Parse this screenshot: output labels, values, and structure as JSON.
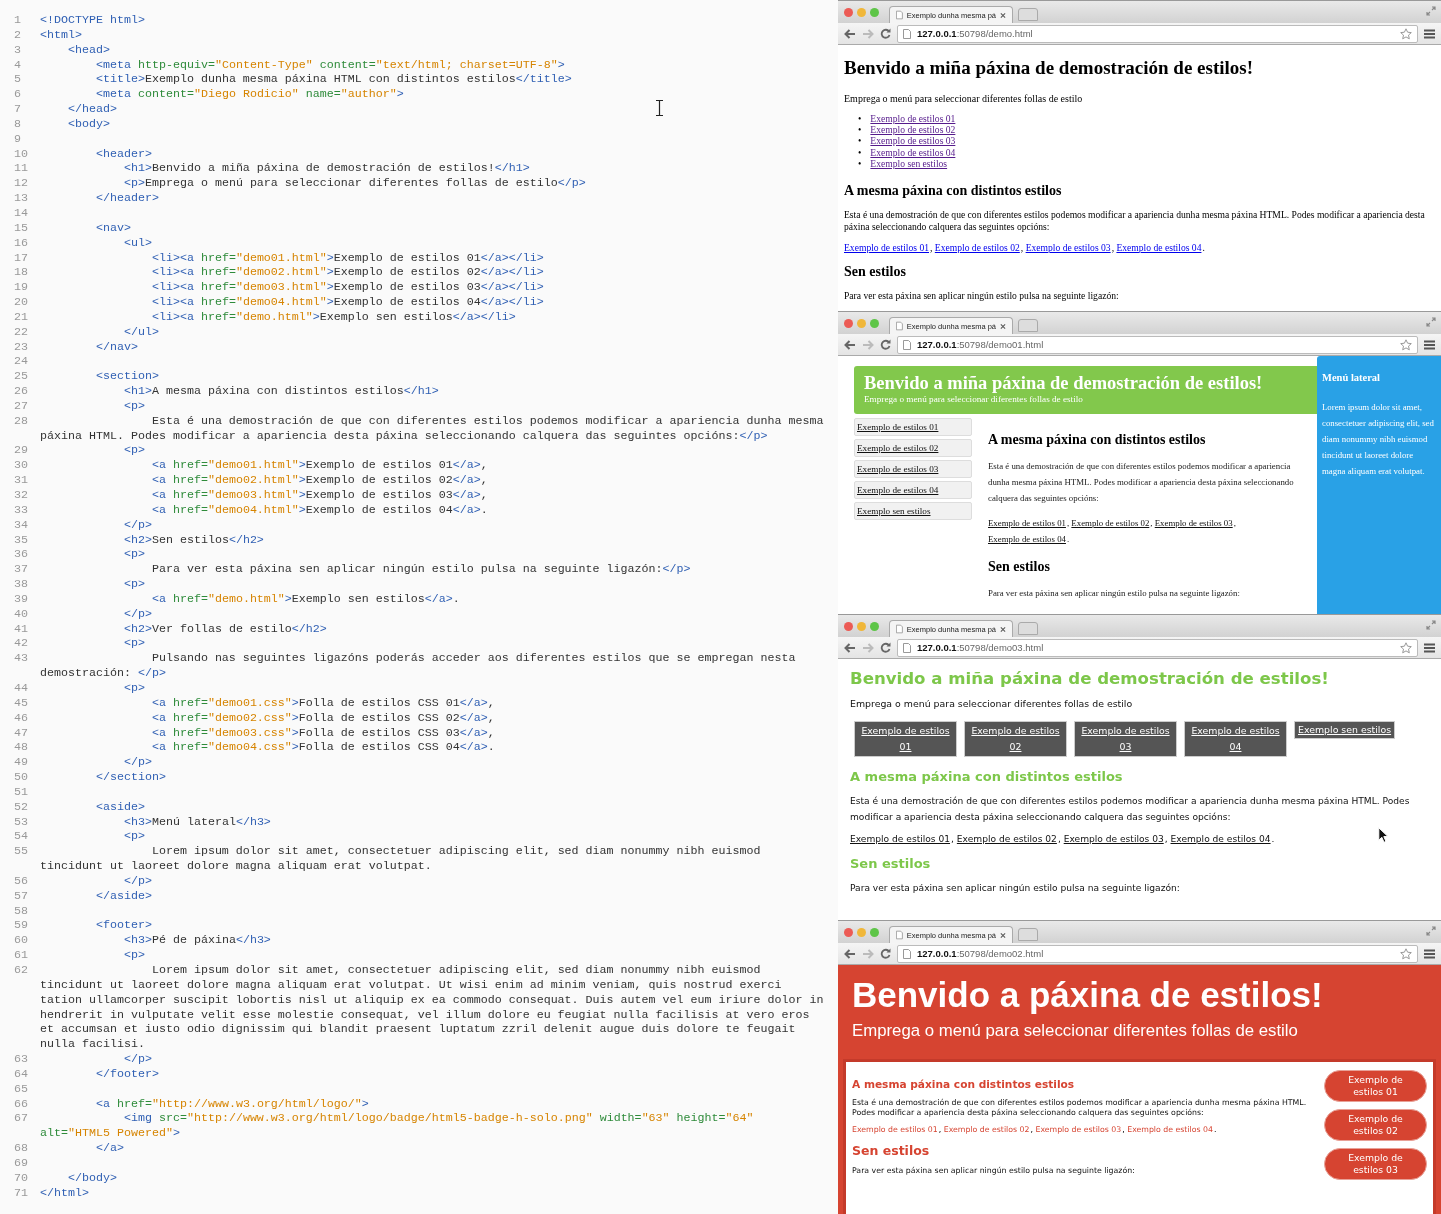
{
  "editor": {
    "lines": [
      {
        "number": "1",
        "text": "<!DOCTYPE html>"
      },
      {
        "number": "2",
        "text": "<html>"
      },
      {
        "number": "3",
        "text": "    <head>"
      },
      {
        "number": "4",
        "text": "        <meta http-equiv=\"Content-Type\" content=\"text/html; charset=UTF-8\">"
      },
      {
        "number": "5",
        "text": "        <title>Exemplo dunha mesma páxina HTML con distintos estilos</title>"
      },
      {
        "number": "6",
        "text": "        <meta content=\"Diego Rodicio\" name=\"author\">"
      },
      {
        "number": "7",
        "text": "    </head>"
      },
      {
        "number": "8",
        "text": "    <body>"
      },
      {
        "number": "9"
      },
      {
        "number": "10",
        "text": "        <header>"
      },
      {
        "number": "11",
        "text": "            <h1>Benvido a miña páxina de demostración de estilos!</h1>"
      },
      {
        "number": "12",
        "text": "            <p>Emprega o menú para seleccionar diferentes follas de estilo</p>"
      },
      {
        "number": "13",
        "text": "        </header>"
      },
      {
        "number": "14"
      },
      {
        "number": "15",
        "text": "        <nav>"
      },
      {
        "number": "16",
        "text": "            <ul>"
      },
      {
        "number": "17",
        "text": "                <li><a href=\"demo01.html\">Exemplo de estilos 01</a></li>"
      },
      {
        "number": "18",
        "text": "                <li><a href=\"demo02.html\">Exemplo de estilos 02</a></li>"
      },
      {
        "number": "19",
        "text": "                <li><a href=\"demo03.html\">Exemplo de estilos 03</a></li>"
      },
      {
        "number": "20",
        "text": "                <li><a href=\"demo04.html\">Exemplo de estilos 04</a></li>"
      },
      {
        "number": "21",
        "text": "                <li><a href=\"demo.html\">Exemplo sen estilos</a></li>"
      },
      {
        "number": "22",
        "text": "            </ul>"
      },
      {
        "number": "23",
        "text": "        </nav>"
      },
      {
        "number": "24"
      },
      {
        "number": "25",
        "text": "        <section>"
      },
      {
        "number": "26",
        "text": "            <h1>A mesma páxina con distintos estilos</h1>"
      },
      {
        "number": "27",
        "text": "            <p>"
      },
      {
        "number": "28",
        "text": "                Esta é una demostración de que con diferentes estilos podemos modificar a apariencia dunha mesma páxina HTML. Podes modificar a apariencia desta páxina seleccionando calquera das seguintes opcións:</p>"
      },
      {
        "number": "29",
        "text": "            <p>"
      },
      {
        "number": "30",
        "text": "                <a href=\"demo01.html\">Exemplo de estilos 01</a>,"
      },
      {
        "number": "31",
        "text": "                <a href=\"demo02.html\">Exemplo de estilos 02</a>,"
      },
      {
        "number": "32",
        "text": "                <a href=\"demo03.html\">Exemplo de estilos 03</a>,"
      },
      {
        "number": "33",
        "text": "                <a href=\"demo04.html\">Exemplo de estilos 04</a>."
      },
      {
        "number": "34",
        "text": "            </p>"
      },
      {
        "number": "35",
        "text": "            <h2>Sen estilos</h2>"
      },
      {
        "number": "36",
        "text": "            <p>"
      },
      {
        "number": "37",
        "text": "                Para ver esta páxina sen aplicar ningún estilo pulsa na seguinte ligazón:</p>"
      },
      {
        "number": "38",
        "text": "            <p>"
      },
      {
        "number": "39",
        "text": "                <a href=\"demo.html\">Exemplo sen estilos</a>."
      },
      {
        "number": "40",
        "text": "            </p>"
      },
      {
        "number": "41",
        "text": "            <h2>Ver follas de estilo</h2>"
      },
      {
        "number": "42",
        "text": "            <p>"
      },
      {
        "number": "43",
        "text": "                Pulsando nas seguintes ligazóns poderás acceder aos diferentes estilos que se empregan nesta demostración: </p>"
      },
      {
        "number": "44",
        "text": "            <p>"
      },
      {
        "number": "45",
        "text": "                <a href=\"demo01.css\">Folla de estilos CSS 01</a>,"
      },
      {
        "number": "46",
        "text": "                <a href=\"demo02.css\">Folla de estilos CSS 02</a>,"
      },
      {
        "number": "47",
        "text": "                <a href=\"demo03.css\">Folla de estilos CSS 03</a>,"
      },
      {
        "number": "48",
        "text": "                <a href=\"demo04.css\">Folla de estilos CSS 04</a>."
      },
      {
        "number": "49",
        "text": "            </p>"
      },
      {
        "number": "50",
        "text": "        </section>"
      },
      {
        "number": "51"
      },
      {
        "number": "52",
        "text": "        <aside>"
      },
      {
        "number": "53",
        "text": "            <h3>Menú lateral</h3>"
      },
      {
        "number": "54",
        "text": "            <p>"
      },
      {
        "number": "55",
        "text": "                Lorem ipsum dolor sit amet, consectetuer adipiscing elit, sed diam nonummy nibh euismod tincidunt ut laoreet dolore magna aliquam erat volutpat."
      },
      {
        "number": "56",
        "text": "            </p>"
      },
      {
        "number": "57",
        "text": "        </aside>"
      },
      {
        "number": "58"
      },
      {
        "number": "59",
        "text": "        <footer>"
      },
      {
        "number": "60",
        "text": "            <h3>Pé de páxina</h3>"
      },
      {
        "number": "61",
        "text": "            <p>"
      },
      {
        "number": "62",
        "text": "                Lorem ipsum dolor sit amet, consectetuer adipiscing elit, sed diam nonummy nibh euismod tincidunt ut laoreet dolore magna aliquam erat volutpat. Ut wisi enim ad minim veniam, quis nostrud exerci tation ullamcorper suscipit lobortis nisl ut aliquip ex ea commodo consequat. Duis autem vel eum iriure dolor in hendrerit in vulputate velit esse molestie consequat, vel illum dolore eu feugiat nulla facilisis at vero eros et accumsan et iusto odio dignissim qui blandit praesent luptatum zzril delenit augue duis dolore te feugait nulla facilisi."
      },
      {
        "number": "63",
        "text": "            </p>"
      },
      {
        "number": "64",
        "text": "        </footer>"
      },
      {
        "number": "65"
      },
      {
        "number": "66",
        "text": "        <a href=\"http://www.w3.org/html/logo/\">"
      },
      {
        "number": "67",
        "text": "            <img src=\"http://www.w3.org/html/logo/badge/html5-badge-h-solo.png\" width=\"63\" height=\"64\" alt=\"HTML5 Powered\">"
      },
      {
        "number": "68",
        "text": "        </a>"
      },
      {
        "number": "69"
      },
      {
        "number": "70",
        "text": "    </body>"
      },
      {
        "number": "71",
        "text": "</html>"
      }
    ]
  },
  "browsers": [
    {
      "kind": "plain",
      "tab_title": "Exemplo dunha mesma pá",
      "url_host": "127.0.0.1",
      "url_path": ":50798/demo.html",
      "heading": "Benvido a miña páxina de demostración de estilos!",
      "subtitle": "Emprega o menú para seleccionar diferentes follas de estilo",
      "nav": [
        {
          "marker": "•",
          "label": "Exemplo de estilos 01",
          "visited": true
        },
        {
          "marker": "•",
          "label": "Exemplo de estilos 02",
          "visited": true
        },
        {
          "marker": "•",
          "label": "Exemplo de estilos 03",
          "visited": true
        },
        {
          "marker": "•",
          "label": "Exemplo de estilos 04",
          "visited": true
        },
        {
          "marker": "•",
          "label": "Exemplo sen estilos",
          "visited": true
        }
      ],
      "section_heading": "A mesma páxina con distintos estilos",
      "paragraph": "Esta é una demostración de que con diferentes estilos podemos modificar a apariencia dunha mesma páxina HTML. Podes modificar a apariencia desta páxina seleccionando calquera das seguintes opcións:",
      "links": [
        {
          "label": "Exemplo de estilos 01",
          "after": ",",
          "visited": false
        },
        {
          "label": "Exemplo de estilos 02",
          "after": ",",
          "visited": false
        },
        {
          "label": "Exemplo de estilos 03",
          "after": ",",
          "visited": false
        },
        {
          "label": "Exemplo de estilos 04",
          "after": ".",
          "visited": false
        }
      ],
      "heading_2": "Sen estilos",
      "paragraph_2": "Para ver esta páxina sen aplicar ningún estilo pulsa na seguinte ligazón:"
    },
    {
      "kind": "green_sidebar",
      "tab_title": "Exemplo dunha mesma pá",
      "url_host": "127.0.0.1",
      "url_path": ":50798/demo01.html",
      "heading": "Benvido a miña páxina de demostración de estilos!",
      "subtitle": "Emprega o menú para seleccionar diferentes follas de estilo",
      "nav": [
        {
          "label": "Exemplo de estilos 01"
        },
        {
          "label": "Exemplo de estilos 02"
        },
        {
          "label": "Exemplo de estilos 03"
        },
        {
          "label": "Exemplo de estilos 04"
        },
        {
          "label": "Exemplo sen estilos"
        }
      ],
      "section_heading": "A mesma páxina con distintos estilos",
      "paragraph": "Esta é una demostración de que con diferentes estilos podemos modificar a apariencia dunha mesma páxina HTML. Podes modificar a apariencia desta páxina seleccionando calquera das seguintes opcións:",
      "links": [
        {
          "label": "Exemplo de estilos 01",
          "after": ","
        },
        {
          "label": "Exemplo de estilos 02",
          "after": ","
        },
        {
          "label": "Exemplo de estilos 03",
          "after": ","
        },
        {
          "label": "Exemplo de estilos 04",
          "after": "."
        }
      ],
      "heading_2": "Sen estilos",
      "paragraph_2": "Para ver esta páxina sen aplicar ningún estilo pulsa na seguinte ligazón:",
      "aside": {
        "heading": "Menú lateral",
        "text": "Lorem ipsum dolor sit amet, consectetuer adipiscing elit, sed diam nonummy nibh euismod tincidunt ut laoreet dolore magna aliquam erat volutpat."
      }
    },
    {
      "kind": "dark_buttons",
      "tab_title": "Exemplo dunha mesma pá",
      "url_host": "127.0.0.1",
      "url_path": ":50798/demo03.html",
      "heading": "Benvido a miña páxina de demostración de estilos!",
      "subtitle": "Emprega o menú para seleccionar diferentes follas de estilo",
      "nav": [
        {
          "label": "Exemplo de estilos 01"
        },
        {
          "label": "Exemplo de estilos 02"
        },
        {
          "label": "Exemplo de estilos 03"
        },
        {
          "label": "Exemplo de estilos 04"
        },
        {
          "label": "Exemplo sen estilos"
        }
      ],
      "section_heading": "A mesma páxina con distintos estilos",
      "paragraph": "Esta é una demostración de que con diferentes estilos podemos modificar a apariencia dunha mesma páxina HTML. Podes modificar a apariencia desta páxina seleccionando calquera das seguintes opcións:",
      "links": [
        {
          "label": "Exemplo de estilos 01",
          "after": ","
        },
        {
          "label": "Exemplo de estilos 02",
          "after": ","
        },
        {
          "label": "Exemplo de estilos 03",
          "after": ","
        },
        {
          "label": "Exemplo de estilos 04",
          "after": "."
        }
      ],
      "heading_2": "Sen estilos",
      "paragraph_2": "Para ver esta páxina sen aplicar ningún estilo pulsa na seguinte ligazón:"
    },
    {
      "kind": "red_banner",
      "tab_title": "Exemplo dunha mesma pá",
      "url_host": "127.0.0.1",
      "url_path": ":50798/demo02.html",
      "heading": "Benvido a páxina de estilos!",
      "subtitle": "Emprega o menú para seleccionar diferentes follas de estilo",
      "nav": [
        {
          "label": "Exemplo de estilos 01"
        },
        {
          "label": "Exemplo de estilos 02"
        },
        {
          "label": "Exemplo de estilos 03"
        }
      ],
      "section_heading": "A mesma páxina con distintos estilos",
      "paragraph": "Esta é una demostración de que con diferentes estilos podemos modificar a apariencia dunha mesma páxina HTML. Podes modificar a apariencia desta páxina seleccionando calquera das seguintes opcións:",
      "links": [
        {
          "label": "Exemplo de estilos 01",
          "after": ","
        },
        {
          "label": "Exemplo de estilos 02",
          "after": ","
        },
        {
          "label": "Exemplo de estilos 03",
          "after": ","
        },
        {
          "label": "Exemplo de estilos 04",
          "after": "."
        }
      ],
      "heading_2": "Sen estilos",
      "paragraph_2": "Para ver esta páxina sen aplicar ningún estilo pulsa na seguinte ligazón:"
    }
  ]
}
